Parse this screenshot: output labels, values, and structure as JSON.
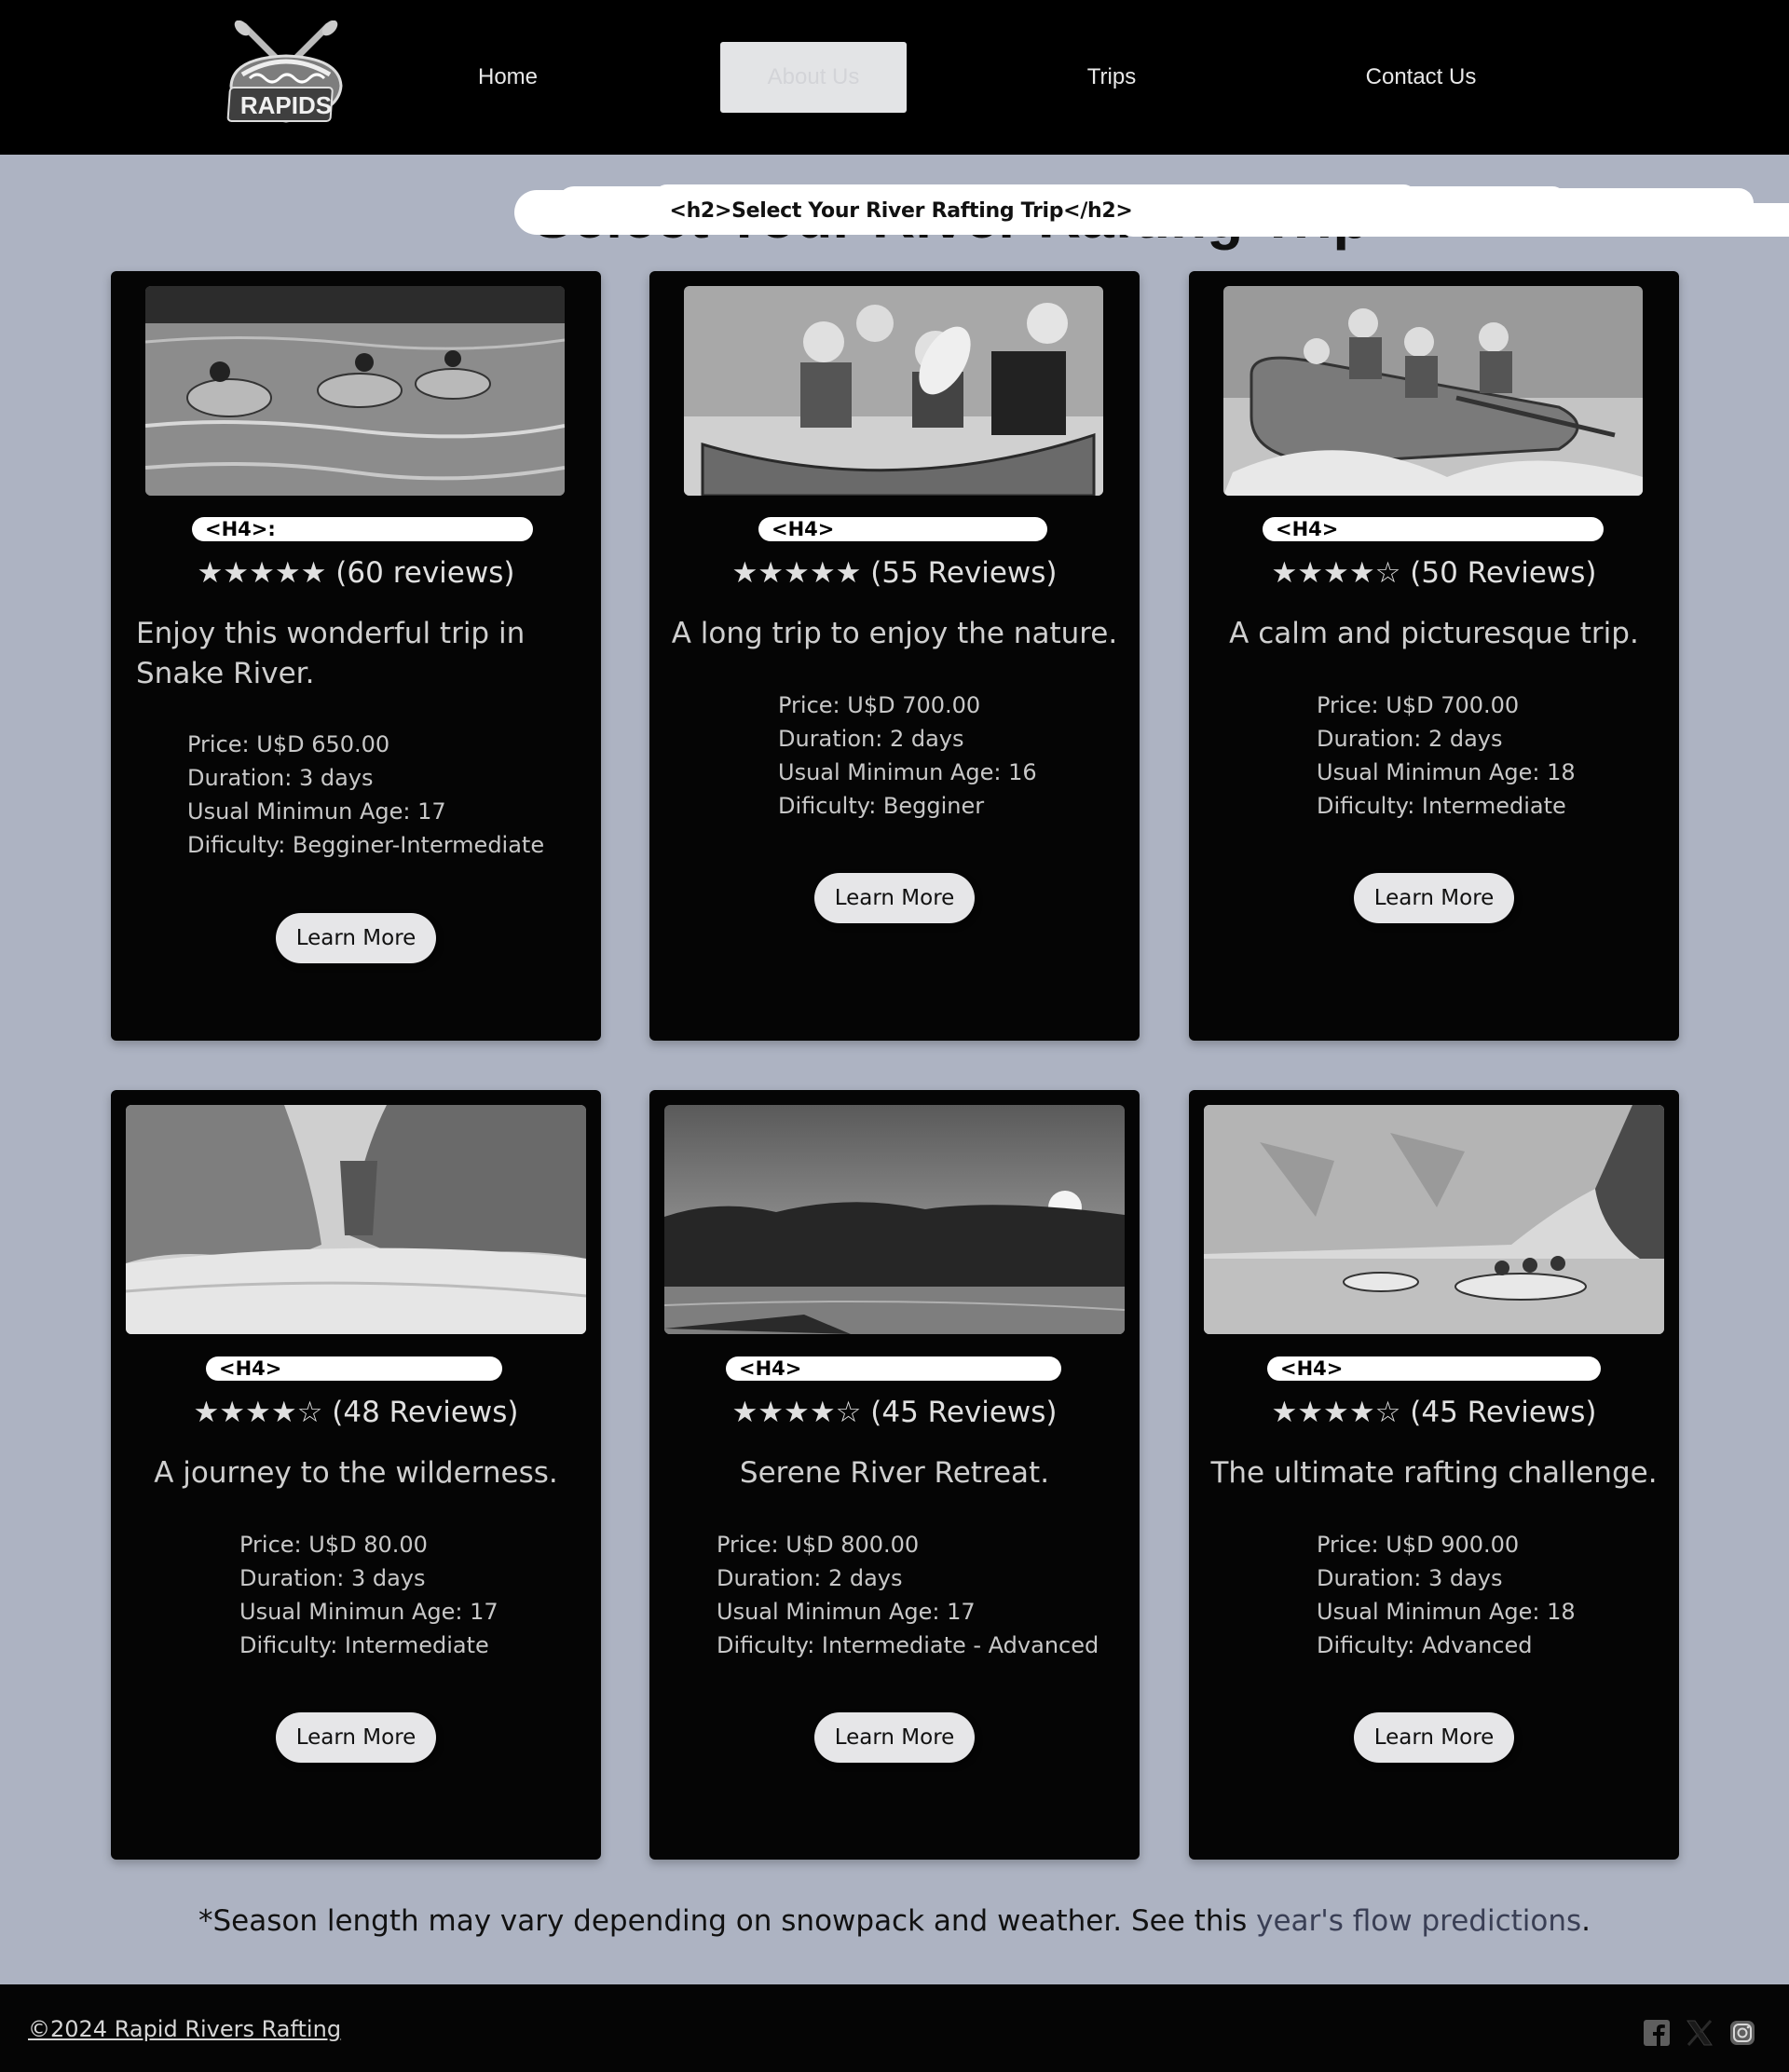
{
  "logo": {
    "text": "RAPIDS",
    "icon": "crossed-paddles-raft-logo"
  },
  "nav": {
    "home": "Home",
    "about": "About Us",
    "trips": "Trips",
    "contact": "Contact Us"
  },
  "heading": {
    "ghost_text": "Select Your River Rafting Trip",
    "annotation": "<h2>Select Your River Rafting Trip</h2>"
  },
  "cards": [
    {
      "h4_label": "<H4>:",
      "rating": "★★★★★ (60 reviews)",
      "description": "Enjoy this wonderful trip in Snake River.",
      "price": "Price: U$D 650.00",
      "duration": "Duration: 3 days",
      "min_age": "Usual Minimun Age: 17",
      "difficulty": "Dificulty: Begginer-Intermediate",
      "button": "Learn More"
    },
    {
      "h4_label": "<H4>",
      "rating": "★★★★★ (55 Reviews)",
      "description": "A long trip to enjoy the nature.",
      "price": "Price: U$D 700.00",
      "duration": "Duration: 2 days",
      "min_age": "Usual Minimun Age: 16",
      "difficulty": "Dificulty: Begginer",
      "button": "Learn More"
    },
    {
      "h4_label": "<H4>",
      "rating": "★★★★☆ (50 Reviews)",
      "description": "A calm and picturesque trip.",
      "price": "Price: U$D 700.00",
      "duration": "Duration: 2 days",
      "min_age": "Usual Minimun Age: 18",
      "difficulty": "Dificulty: Intermediate",
      "button": "Learn More"
    },
    {
      "h4_label": "<H4>",
      "rating": "★★★★☆ (48 Reviews)",
      "description": "A journey to the wilderness.",
      "price": "Price: U$D 80.00",
      "duration": "Duration: 3 days",
      "min_age": "Usual Minimun Age: 17",
      "difficulty": "Dificulty: Intermediate",
      "button": "Learn More"
    },
    {
      "h4_label": "<H4>",
      "rating": "★★★★☆ (45 Reviews)",
      "description": "Serene River Retreat.",
      "price": "Price: U$D 800.00",
      "duration": "Duration: 2 days",
      "min_age": "Usual Minimun Age: 17",
      "difficulty": "Dificulty: Intermediate - Advanced",
      "button": "Learn More"
    },
    {
      "h4_label": "<H4>",
      "rating": "★★★★☆ (45 Reviews)",
      "description": "The ultimate rafting challenge.",
      "price": "Price: U$D 900.00",
      "duration": "Duration: 3 days",
      "min_age": "Usual Minimun Age: 18",
      "difficulty": "Dificulty: Advanced",
      "button": "Learn More"
    }
  ],
  "note": {
    "text": "*Season length may vary depending on snowpack and weather. See this ",
    "link": "year's flow predictions",
    "end": "."
  },
  "footer": {
    "copyright": "©2024 Rapid Rivers Rafting",
    "social": [
      "facebook-icon",
      "x-icon",
      "instagram-icon"
    ]
  },
  "colors": {
    "page_bg": "#adb3c2",
    "header_bg": "#000000",
    "card_bg": "#050505",
    "button_bg": "#e6e6e8"
  }
}
